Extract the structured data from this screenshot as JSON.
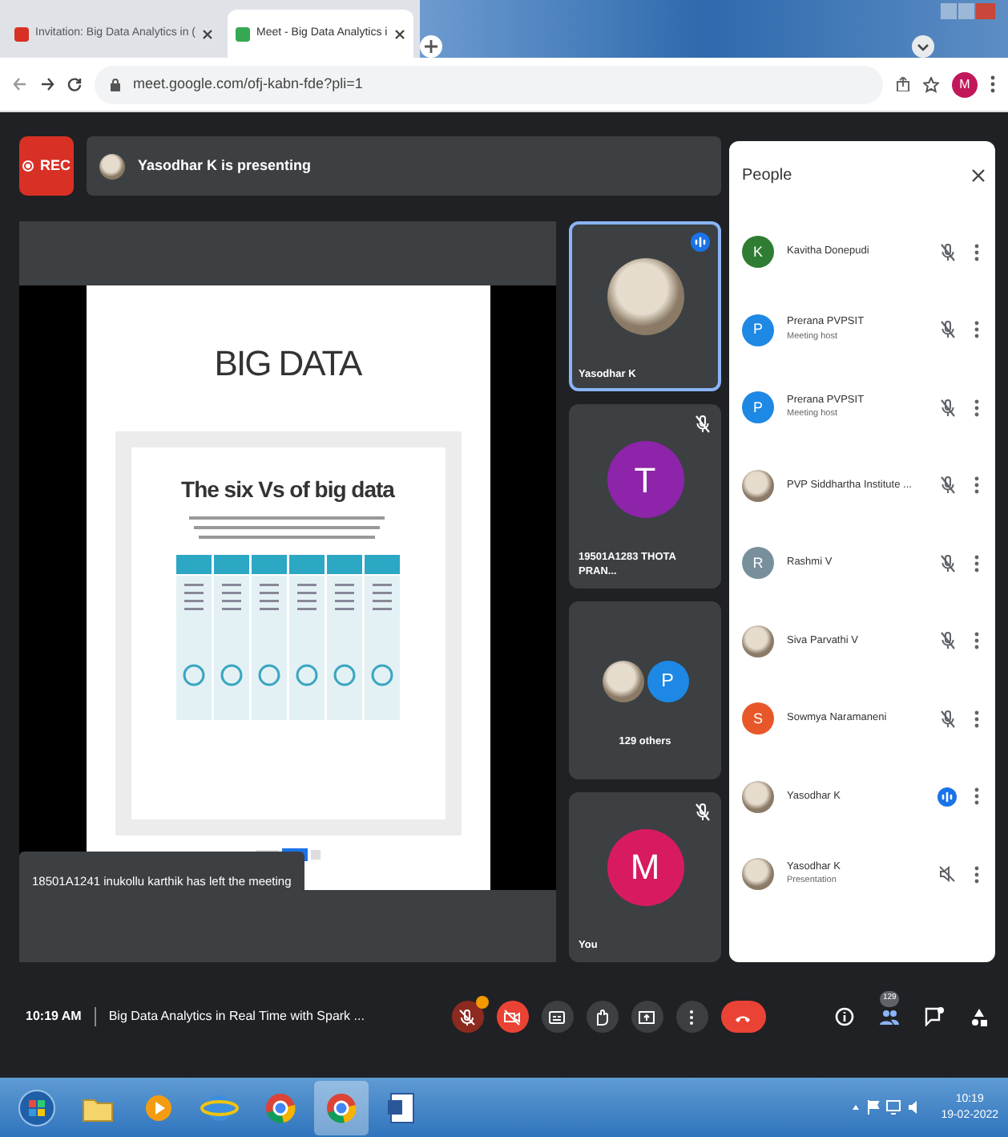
{
  "browser": {
    "tabs": [
      {
        "title": "Invitation: Big Data Analytics in (",
        "selected": false
      },
      {
        "title": "Meet - Big Data Analytics i",
        "selected": true
      }
    ],
    "address": "meet.google.com/ofj-kabn-fde?pli=1",
    "profile_letter": "M"
  },
  "meeting": {
    "rec_label": "REC",
    "presenting": "Yasodhar K is presenting",
    "slide": {
      "title": "BIG DATA",
      "subtitle": "The six Vs of big data"
    },
    "toast": "18501A1241 inukollu karthik has left the meeting",
    "tiles": [
      {
        "kind": "person",
        "name": "Yasodhar K",
        "avatars": [
          {
            "kind": "photo"
          }
        ],
        "speaking": true,
        "selected": true
      },
      {
        "kind": "person",
        "name": "19501A1283 THOTA PRAN...",
        "avatars": [
          {
            "kind": "letter",
            "letter": "T",
            "color": "#8e24aa"
          }
        ],
        "muted": true,
        "speaking": false,
        "selected": false
      },
      {
        "kind": "group",
        "name": "129 others",
        "avatars": [
          {
            "kind": "photo"
          },
          {
            "kind": "letter",
            "letter": "P",
            "color": "#1e88e5"
          }
        ],
        "muted": false,
        "speaking": false,
        "selected": false
      },
      {
        "kind": "person",
        "name": "You",
        "avatars": [
          {
            "kind": "letter",
            "letter": "M",
            "color": "#d81b60"
          }
        ],
        "muted": true,
        "speaking": false,
        "selected": false
      }
    ],
    "people": {
      "title": "People",
      "participants": [
        {
          "kind": "person",
          "name": "Kavitha Donepudi",
          "avatar": {
            "kind": "letter",
            "letter": "K",
            "color": "#2e7d32"
          },
          "muted": true,
          "speaking": false
        },
        {
          "kind": "person",
          "name": "Prerana PVPSIT",
          "role": "Meeting host",
          "avatar": {
            "kind": "letter",
            "letter": "P",
            "color": "#1e88e5"
          },
          "muted": true,
          "speaking": false
        },
        {
          "kind": "person",
          "name": "Prerana PVPSIT",
          "role": "Meeting host",
          "avatar": {
            "kind": "letter",
            "letter": "P",
            "color": "#1e88e5"
          },
          "muted": true,
          "speaking": false
        },
        {
          "kind": "person",
          "name": "PVP Siddhartha Institute ...",
          "avatar": {
            "kind": "photo"
          },
          "muted": true,
          "speaking": false
        },
        {
          "kind": "person",
          "name": "Rashmi V",
          "avatar": {
            "kind": "letter",
            "letter": "R",
            "color": "#78909c"
          },
          "muted": true,
          "speaking": false
        },
        {
          "kind": "person",
          "name": "Siva Parvathi V",
          "avatar": {
            "kind": "photo"
          },
          "muted": true,
          "speaking": false
        },
        {
          "kind": "person",
          "name": "Sowmya Naramaneni",
          "avatar": {
            "kind": "letter",
            "letter": "S",
            "color": "#e8572a"
          },
          "muted": true,
          "speaking": false
        },
        {
          "kind": "person",
          "name": "Yasodhar K",
          "avatar": {
            "kind": "photo"
          },
          "speaking": true
        },
        {
          "kind": "presentation",
          "name": "Yasodhar K",
          "role": "Presentation",
          "avatar": {
            "kind": "photo"
          },
          "muted": true,
          "speaking": false
        }
      ]
    },
    "bottom": {
      "time": "10:19 AM",
      "title": "Big Data Analytics in Real Time with Spark ...",
      "controls": [
        {
          "kind": "mic",
          "off": true,
          "notice": true
        },
        {
          "kind": "camera",
          "off": true
        },
        {
          "kind": "captions",
          "off": false
        },
        {
          "kind": "hand",
          "off": false
        },
        {
          "kind": "present",
          "off": false
        },
        {
          "kind": "more",
          "off": false
        },
        {
          "kind": "hangup",
          "off": true
        }
      ],
      "side": [
        {
          "kind": "info",
          "selected": false
        },
        {
          "kind": "people",
          "badge": "129",
          "selected": true
        },
        {
          "kind": "chat",
          "selected": false
        },
        {
          "kind": "activities",
          "selected": false
        }
      ]
    }
  },
  "taskbar": {
    "apps": [
      {
        "kind": "start",
        "selected": false
      },
      {
        "kind": "folder",
        "selected": false
      },
      {
        "kind": "player",
        "selected": false
      },
      {
        "kind": "globe",
        "selected": false
      },
      {
        "kind": "browser",
        "selected": false
      },
      {
        "kind": "browser",
        "selected": true
      },
      {
        "kind": "document",
        "selected": false
      }
    ],
    "clock": {
      "time": "10:19",
      "date": "19-02-2022"
    }
  }
}
